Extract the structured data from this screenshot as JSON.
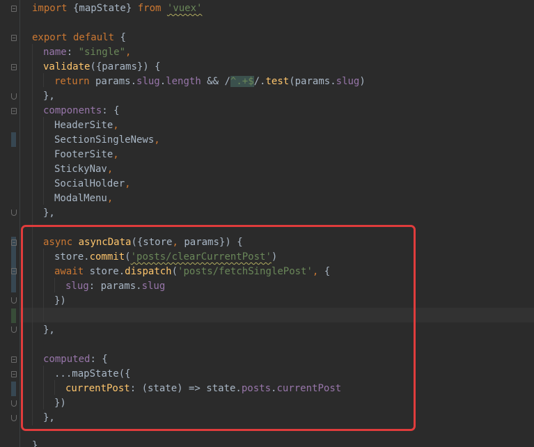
{
  "code": {
    "line1": {
      "t1": "import",
      "t2": " {mapState} ",
      "t3": "from",
      "t4": " ",
      "t5": "'vuex'"
    },
    "line3": {
      "t1": "export default",
      "t2": " {"
    },
    "line4": {
      "t1": "name",
      "t2": ": ",
      "t3": "\"single\"",
      "t4": ","
    },
    "line5": {
      "t1": "validate",
      "t2": "({params}) {"
    },
    "line6": {
      "t1": "return",
      "t2": " params.",
      "t3": "slug",
      "t4": ".",
      "t5": "length",
      "t6": " && /",
      "t7": "^.+$",
      "t8": "/.",
      "t9": "test",
      "t10": "(params.",
      "t11": "slug",
      "t12": ")"
    },
    "line7": {
      "t1": "},"
    },
    "line8": {
      "t1": "components",
      "t2": ": {"
    },
    "line9": {
      "t1": "HeaderSite",
      "t2": ","
    },
    "line10": {
      "t1": "SectionSingleNews",
      "t2": ","
    },
    "line11": {
      "t1": "FooterSite",
      "t2": ","
    },
    "line12": {
      "t1": "StickyNav",
      "t2": ","
    },
    "line13": {
      "t1": "SocialHolder",
      "t2": ","
    },
    "line14": {
      "t1": "ModalMenu",
      "t2": ","
    },
    "line15": {
      "t1": "},"
    },
    "line17": {
      "t1": "async",
      "t2": " ",
      "t3": "asyncData",
      "t4": "({store",
      "t5": ",",
      "t6": " params}) {"
    },
    "line18": {
      "t1": "store.",
      "t2": "commit",
      "t3": "(",
      "t4": "'posts/clearCurrentPost'",
      "t5": ")"
    },
    "line19": {
      "t1": "await",
      "t2": " store.",
      "t3": "dispatch",
      "t4": "(",
      "t5": "'posts/fetchSinglePost'",
      "t6": ",",
      "t7": " {"
    },
    "line20": {
      "t1": "slug",
      "t2": ": params.",
      "t3": "slug"
    },
    "line21": {
      "t1": "})"
    },
    "line23": {
      "t1": "},"
    },
    "line25": {
      "t1": "computed",
      "t2": ": {"
    },
    "line26": {
      "t1": "...",
      "t2": "mapState",
      "t3": "({"
    },
    "line27": {
      "t1": "currentPost",
      "t2": ": (state) => state.",
      "t3": "posts",
      "t4": ".",
      "t5": "currentPost"
    },
    "line28": {
      "t1": "})"
    },
    "line29": {
      "t1": "},"
    },
    "line31": {
      "t1": "}"
    }
  },
  "colors": {
    "background": "#2b2b2b",
    "keyword": "#cc7832",
    "string": "#6a8759",
    "property": "#9876aa",
    "function": "#ffc66d",
    "text": "#a9b7c6",
    "highlight_box": "#e03c3c"
  }
}
